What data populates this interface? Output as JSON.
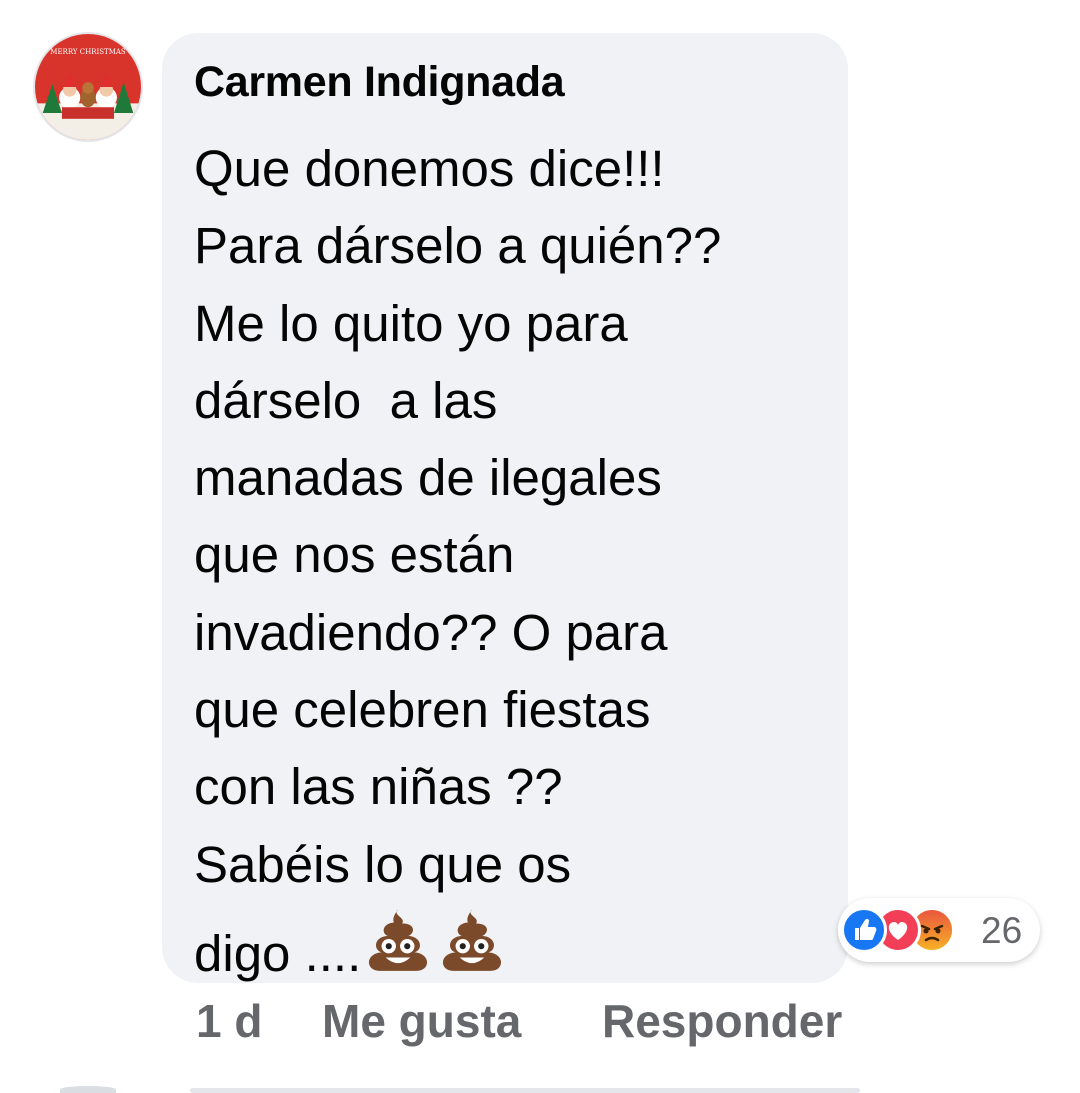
{
  "comment": {
    "author": "Carmen Indignada",
    "lines": [
      "Que donemos dice!!!",
      "Para dárselo a quién??",
      "Me lo quito yo para",
      "dárselo  a las",
      "manadas de ilegales",
      "que nos están",
      "invadiendo?? O para",
      "que celebren fiestas",
      "con las niñas ??",
      "Sabéis lo que os"
    ],
    "last_line_text": "digo ....",
    "last_line_emojis": [
      "poo-emoji",
      "poo-emoji"
    ],
    "avatar": {
      "name": "christmas-profile-avatar",
      "banner_text": "MERRY CHRISTMAS"
    }
  },
  "reactions": {
    "icons": [
      "like-reaction-icon",
      "love-reaction-icon",
      "angry-reaction-icon"
    ],
    "count": "26"
  },
  "actions": {
    "time": "1 d",
    "like": "Me gusta",
    "reply": "Responder"
  },
  "colors": {
    "bubble": "#f0f2f5",
    "text": "#050505",
    "secondary": "#65676b",
    "like_blue": "#1877f2",
    "love_red": "#f33e58",
    "angry_orange": "#f7b125"
  }
}
